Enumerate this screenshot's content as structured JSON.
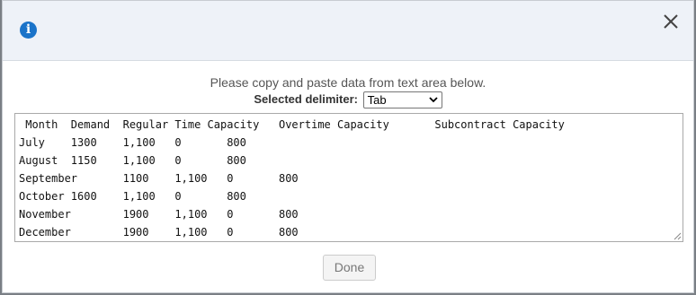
{
  "header": {
    "icon": "info-icon",
    "close_icon": "close-icon"
  },
  "instructions": "Please copy and paste data from text area below.",
  "delimiter": {
    "label": "Selected delimiter:",
    "selected": "Tab",
    "icon": "chevron-down-icon"
  },
  "textarea": {
    "lines": [
      " Month  Demand  Regular Time Capacity   Overtime Capacity       Subcontract Capacity",
      "July    1300    1,100   0       800",
      "August  1150    1,100   0       800",
      "September       1100    1,100   0       800",
      "October 1600    1,100   0       800",
      "November        1900    1,100   0       800",
      "December        1900    1,100   0       800"
    ]
  },
  "done_label": "Done"
}
